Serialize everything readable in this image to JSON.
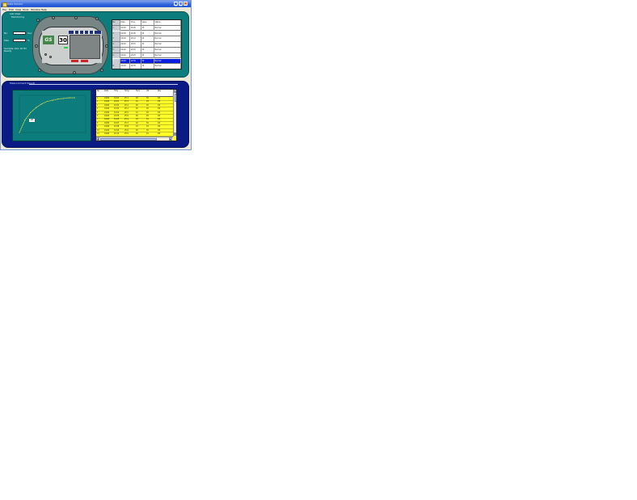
{
  "window": {
    "title": "Data Monitor",
    "controls": {
      "minimize": "_",
      "maximize": "□",
      "close": "×"
    }
  },
  "menu": [
    "File",
    "Edit",
    "View",
    "Tools",
    "Window",
    "Help"
  ],
  "top_panel": {
    "title_line1": "Lab View",
    "title_line2": "Monitoring",
    "fields": [
      {
        "label": "No",
        "value": "",
        "unit": "Sec"
      },
      {
        "label": "Max",
        "value": "",
        "unit": "%"
      }
    ],
    "note_line1": "Sample rate 10 Hz",
    "note_line2": "Ready"
  },
  "instrument": {
    "logo": "GS",
    "reading": "30",
    "led_color": "#2fd04a",
    "button_color": "#cc2525"
  },
  "top_table": {
    "rows": [
      [
        "No",
        "Date",
        "Time",
        "Value",
        "Status"
      ],
      [
        "1",
        "01/02",
        "10:00",
        "30",
        "Normal"
      ],
      [
        "2",
        "01/02",
        "10:05",
        "32",
        "Normal"
      ],
      [
        "3",
        "01/02",
        "10:10",
        "29",
        "Normal"
      ],
      [
        "4",
        "01/02",
        "10:15",
        "31",
        "Normal"
      ],
      [
        "5",
        "01/02",
        "10:20",
        "30",
        "Normal"
      ],
      [
        "6",
        "01/02",
        "10:25",
        "33",
        "Normal"
      ],
      [
        "7",
        "01/02",
        "10:30",
        "30",
        "Normal"
      ],
      [
        "8",
        "01/02",
        "10:35",
        "34",
        "Normal"
      ]
    ],
    "selected_row": 7
  },
  "bottom_panel": {
    "title": "Measurement Result",
    "chart_tag": "20"
  },
  "chart_data": {
    "type": "line",
    "x": [
      0,
      1,
      2,
      3,
      4,
      5,
      6,
      7,
      8,
      9,
      10
    ],
    "values": [
      0,
      10,
      16,
      20,
      23,
      25,
      26,
      27,
      27.5,
      28,
      28
    ],
    "xlim": [
      0,
      12
    ],
    "ylim": [
      0,
      30
    ],
    "grid": false,
    "line_color": "#f0e84a"
  },
  "data_grid": {
    "headers": [
      "No",
      "Date",
      "Time",
      "Temp",
      "Hum",
      "Val",
      "Res"
    ],
    "rows": [
      [
        "1",
        "01/02",
        "10:00",
        "25.1",
        "40",
        "30",
        "OK"
      ],
      [
        "2",
        "01/02",
        "10:01",
        "25.3",
        "41",
        "31",
        "OK"
      ],
      [
        "3",
        "01/02",
        "10:02",
        "25.4",
        "40",
        "30",
        "OK"
      ],
      [
        "4",
        "01/02",
        "10:03",
        "25.2",
        "42",
        "32",
        "OK"
      ],
      [
        "5",
        "01/02",
        "10:04",
        "25.5",
        "41",
        "30",
        "OK"
      ],
      [
        "6",
        "01/02",
        "10:05",
        "25.6",
        "40",
        "29",
        "OK"
      ],
      [
        "7",
        "01/02",
        "10:06",
        "25.4",
        "43",
        "31",
        "OK"
      ],
      [
        "8",
        "01/02",
        "10:07",
        "25.7",
        "42",
        "30",
        "OK"
      ],
      [
        "9",
        "01/02",
        "10:08",
        "25.8",
        "41",
        "33",
        "OK"
      ],
      [
        "10",
        "01/02",
        "10:09",
        "25.6",
        "40",
        "30",
        "OK"
      ],
      [
        "11",
        "01/02",
        "10:10",
        "25.9",
        "42",
        "31",
        "OK"
      ]
    ]
  },
  "colors": {
    "panel_teal": "#0c7c7c",
    "panel_navy": "#0b1b86",
    "grid_yellow": "#ffff2a",
    "selection_blue": "#0a1fe0"
  }
}
